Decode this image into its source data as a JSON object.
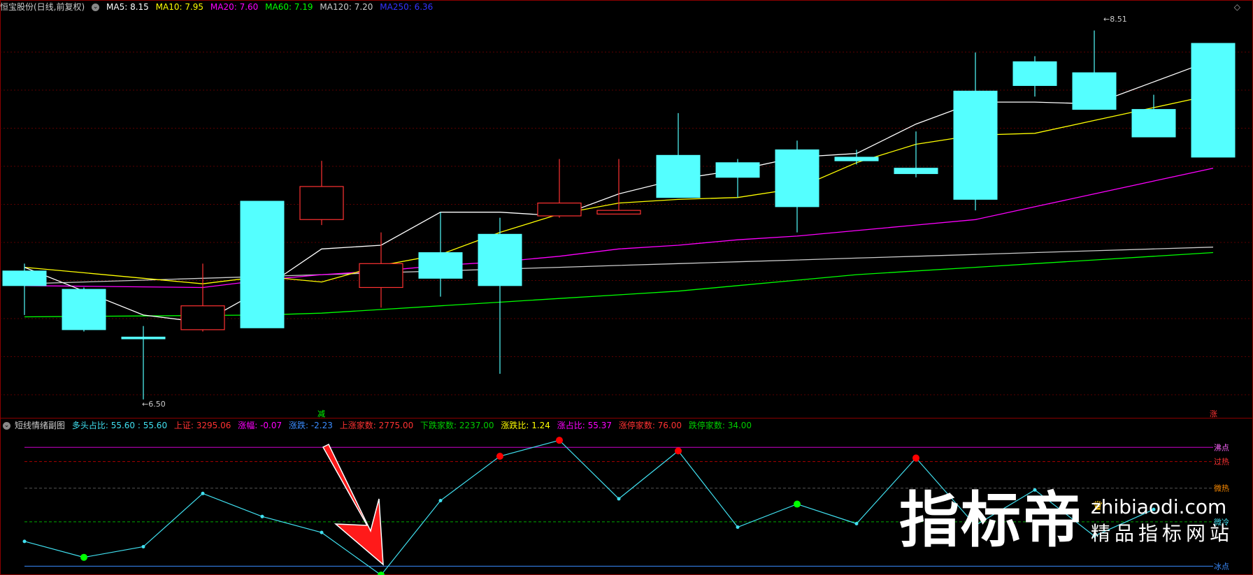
{
  "main_header": {
    "stock_name": "恒宝股份(日线,前复权)",
    "ma5": "MA5: 8.15",
    "ma10": "MA10: 7.95",
    "ma20": "MA20: 7.60",
    "ma60": "MA60: 7.19",
    "ma120": "MA120: 7.20",
    "ma250": "MA250: 6.36"
  },
  "sub_header": {
    "indicator_name": "短线情绪副图",
    "bull_ratio": "多头占比: 55.60 : 55.60",
    "sh_index": "上证: 3295.06",
    "change_amt": "涨幅: -0.07",
    "change_pct": "涨跌: -2.23",
    "up_count": "上涨家数: 2775.00",
    "down_count": "下跌家数: 2237.00",
    "updown_ratio": "涨跌比: 1.24",
    "up_ratio": "涨占比: 55.37",
    "limit_up_count": "涨停家数: 76.00",
    "limit_down_count": "跌停家数: 34.00"
  },
  "colors": {
    "ma5": "#ffffff",
    "ma10": "#ffff00",
    "ma20": "#ff00ff",
    "ma60": "#00ff00",
    "ma120": "#cccccc",
    "ma250": "#0000ff",
    "up": "#ff3232",
    "down": "#54ffff",
    "indicator_line": "#40e0f0"
  },
  "annotations": {
    "high_label": "8.51",
    "low_label": "6.50",
    "reduce_marker": "减",
    "rise_marker": "涨"
  },
  "levels": {
    "boiling": "沸点",
    "overheat": "过热",
    "warm": "微热",
    "cool": "微冷",
    "ice": "冰点"
  },
  "watermark": {
    "main": "指标帝",
    "url": "zhibiaodi.com",
    "tagline": "精品指标网站"
  },
  "chart_data": {
    "type": "candlestick",
    "candles": [
      {
        "o": 7.2,
        "c": 7.12,
        "h": 7.24,
        "l": 6.96
      },
      {
        "o": 7.1,
        "c": 6.88,
        "h": 7.11,
        "l": 6.87
      },
      {
        "o": 6.84,
        "c": 6.83,
        "h": 6.9,
        "l": 6.5
      },
      {
        "o": 6.88,
        "c": 7.01,
        "h": 7.24,
        "l": 6.87
      },
      {
        "o": 7.58,
        "c": 6.89,
        "h": 7.58,
        "l": 6.89
      },
      {
        "o": 7.48,
        "c": 7.66,
        "h": 7.8,
        "l": 7.45
      },
      {
        "o": 7.11,
        "c": 7.24,
        "h": 7.41,
        "l": 7.0
      },
      {
        "o": 7.3,
        "c": 7.16,
        "h": 7.52,
        "l": 7.06
      },
      {
        "o": 7.4,
        "c": 7.12,
        "h": 7.49,
        "l": 6.64
      },
      {
        "o": 7.5,
        "c": 7.57,
        "h": 7.81,
        "l": 7.49
      },
      {
        "o": 7.51,
        "c": 7.53,
        "h": 7.81,
        "l": 7.51
      },
      {
        "o": 7.83,
        "c": 7.6,
        "h": 8.06,
        "l": 7.6
      },
      {
        "o": 7.79,
        "c": 7.71,
        "h": 7.81,
        "l": 7.6
      },
      {
        "o": 7.86,
        "c": 7.55,
        "h": 7.91,
        "l": 7.41
      },
      {
        "o": 7.82,
        "c": 7.8,
        "h": 7.86,
        "l": 7.78
      },
      {
        "o": 7.76,
        "c": 7.73,
        "h": 7.96,
        "l": 7.71
      },
      {
        "o": 8.18,
        "c": 7.59,
        "h": 8.39,
        "l": 7.53
      },
      {
        "o": 8.34,
        "c": 8.21,
        "h": 8.37,
        "l": 8.15
      },
      {
        "o": 8.28,
        "c": 8.08,
        "h": 8.51,
        "l": 8.08
      },
      {
        "o": 8.08,
        "c": 7.93,
        "h": 8.16,
        "l": 7.93
      },
      {
        "o": 8.44,
        "c": 7.82,
        "h": 8.44,
        "l": 7.82
      }
    ],
    "ma5": [
      7.22,
      null,
      6.96,
      6.92,
      7.1,
      7.32,
      7.34,
      7.52,
      7.52,
      7.5,
      7.62,
      7.7,
      7.75,
      7.82,
      7.84,
      8.0,
      8.12,
      8.12,
      8.11,
      8.23
    ],
    "ma10": [
      7.22,
      null,
      null,
      7.13,
      7.17,
      7.14,
      7.23,
      7.29,
      7.41,
      7.51,
      7.57,
      7.59,
      7.6,
      7.65,
      7.79,
      7.89,
      7.94,
      7.95,
      8.02
    ],
    "ma20": [
      7.12,
      null,
      null,
      7.11,
      7.15,
      7.18,
      7.2,
      7.23,
      7.25,
      7.28,
      7.32,
      7.34,
      7.37,
      7.39,
      7.42,
      7.45,
      7.48,
      7.55
    ],
    "ma60": [
      6.95,
      null,
      null,
      null,
      6.96,
      6.97,
      6.99,
      7.01,
      7.03,
      7.05,
      7.07,
      7.09,
      7.12,
      7.15,
      7.18,
      7.2
    ],
    "ma120": [
      7.13,
      7.14,
      7.15,
      7.16,
      7.17,
      7.18,
      7.19,
      7.2
    ],
    "y_range": [
      6.4,
      8.6
    ],
    "indicator": {
      "values": [
        55,
        46,
        52,
        82,
        69,
        60,
        36,
        78,
        103,
        112,
        79,
        106,
        63,
        76,
        65,
        102,
        64,
        84,
        58,
        73
      ],
      "red_dots": [
        8,
        9,
        11,
        15
      ],
      "green_dots": [
        1,
        6,
        13
      ],
      "levels": {
        "boiling": 108,
        "overheat": 100,
        "warm": 85,
        "cool": 66,
        "ice": 41
      },
      "y_range": [
        38,
        116
      ]
    }
  }
}
